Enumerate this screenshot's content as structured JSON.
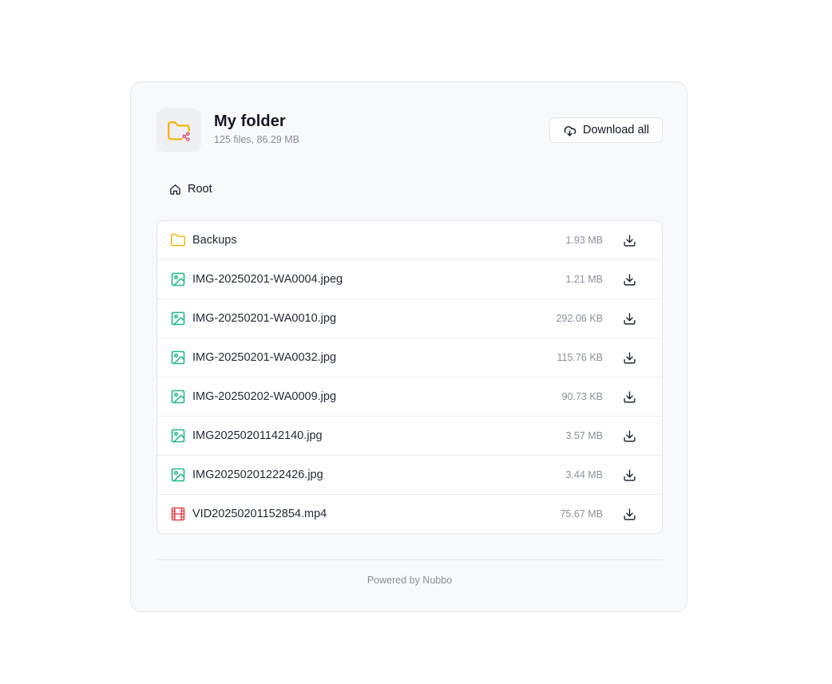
{
  "folder": {
    "title": "My folder",
    "summary": "125 files, 86.29 MB",
    "download_all_label": "Download all"
  },
  "breadcrumb": {
    "root_label": "Root"
  },
  "files": [
    {
      "name": "Backups",
      "size": "1.93 MB",
      "type": "folder"
    },
    {
      "name": "IMG-20250201-WA0004.jpeg",
      "size": "1.21 MB",
      "type": "image"
    },
    {
      "name": "IMG-20250201-WA0010.jpg",
      "size": "292.06 KB",
      "type": "image"
    },
    {
      "name": "IMG-20250201-WA0032.jpg",
      "size": "115.76 KB",
      "type": "image"
    },
    {
      "name": "IMG-20250202-WA0009.jpg",
      "size": "90.73 KB",
      "type": "image"
    },
    {
      "name": "IMG20250201142140.jpg",
      "size": "3.57 MB",
      "type": "image"
    },
    {
      "name": "IMG20250201222426.jpg",
      "size": "3.44 MB",
      "type": "image"
    },
    {
      "name": "VID20250201152854.mp4",
      "size": "75.67 MB",
      "type": "video"
    }
  ],
  "footer": {
    "text": "Powered by Nubbo"
  },
  "colors": {
    "folder": "#f5b50a",
    "share": "#e0607a",
    "image": "#1fb987",
    "video": "#e5484d",
    "muted": "#8a909c"
  }
}
